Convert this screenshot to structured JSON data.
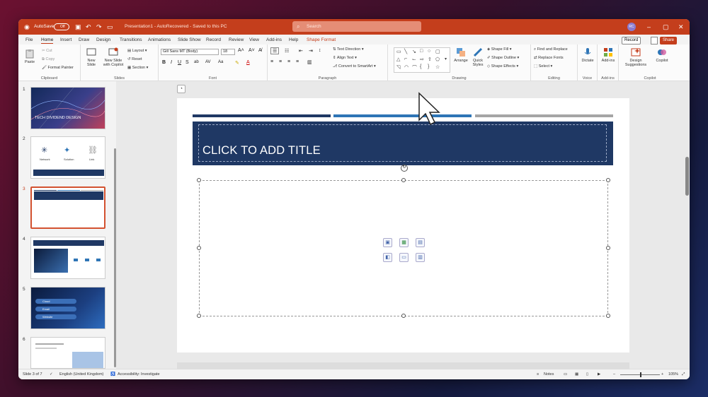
{
  "title_bar": {
    "autosave": "AutoSave",
    "autosave_state": "Off",
    "doc_title": "Presentation1 - AutoRecovered - Saved to this PC",
    "search_placeholder": "Search",
    "user_initials": "RC"
  },
  "tabs": [
    "File",
    "Home",
    "Insert",
    "Draw",
    "Design",
    "Transitions",
    "Animations",
    "Slide Show",
    "Record",
    "Review",
    "View",
    "Add-ins",
    "Help",
    "Shape Format"
  ],
  "tab_selected": "Home",
  "record_label": "Record",
  "share_label": "Share",
  "ribbon": {
    "clipboard": {
      "paste": "Paste",
      "cut": "Cut",
      "copy": "Copy",
      "format_painter": "Format Painter",
      "label": "Clipboard"
    },
    "slides": {
      "new_slide": "New Slide",
      "new_slide_copilot": "New Slide with Copilot",
      "layout": "Layout",
      "reset": "Reset",
      "section": "Section",
      "label": "Slides"
    },
    "font": {
      "font_name": "Gill Sans MT (Body)",
      "font_size": "18",
      "label": "Font"
    },
    "paragraph": {
      "text_direction": "Text Direction",
      "align_text": "Align Text",
      "convert_smartart": "Convert to SmartArt",
      "label": "Paragraph"
    },
    "drawing": {
      "arrange": "Arrange",
      "quick_styles": "Quick Styles",
      "shape_fill": "Shape Fill",
      "shape_outline": "Shape Outline",
      "shape_effects": "Shape Effects",
      "label": "Drawing"
    },
    "editing": {
      "find_replace": "Find and Replace",
      "replace_fonts": "Replace Fonts",
      "select": "Select",
      "label": "Editing"
    },
    "voice": {
      "dictate": "Dictate",
      "label": "Voice"
    },
    "addins": {
      "addins": "Add-ins",
      "label": "Add-ins"
    },
    "designer": {
      "design_suggestions": "Design Suggestions",
      "copilot": "Copilot",
      "label": "Copilot"
    }
  },
  "thumbnails": [
    {
      "num": "1",
      "title": "TECH DIVIDEND DESIGN"
    },
    {
      "num": "2",
      "items": [
        "Network",
        "Solution",
        "Link"
      ]
    },
    {
      "num": "3"
    },
    {
      "num": "4"
    },
    {
      "num": "5",
      "items": [
        "Cloud",
        "Email",
        "Website"
      ]
    },
    {
      "num": "6"
    }
  ],
  "slide": {
    "title_placeholder": "CLICK TO ADD TITLE"
  },
  "status": {
    "slide_of": "Slide 3 of 7",
    "language": "English (United Kingdom)",
    "accessibility": "Accessibility: Investigate",
    "notes": "Notes",
    "zoom": "105%"
  },
  "colors": {
    "title_bar": "#c43e1c",
    "slide_title_bg": "#1f3864",
    "bar1": "#1f3864",
    "bar2": "#2e75b6",
    "bar3": "#a5a5a5"
  }
}
